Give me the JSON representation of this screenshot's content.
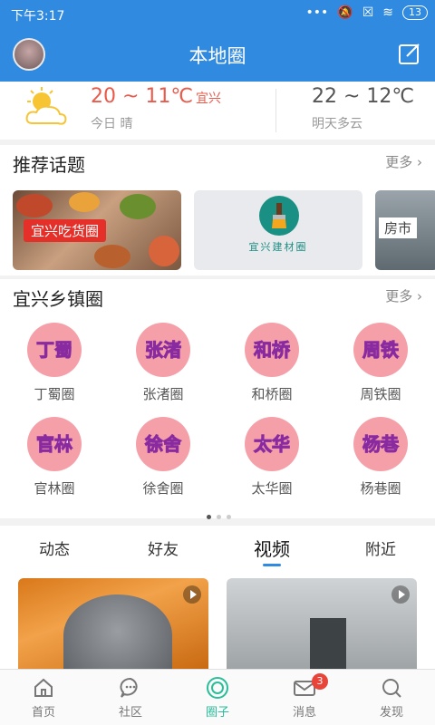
{
  "status_bar": {
    "time": "下午3:17",
    "battery": "13"
  },
  "header": {
    "title": "本地圈"
  },
  "weather": {
    "today_temp": "20 ~ 11℃",
    "city": "宜兴",
    "today_label": "今日 晴",
    "tomorrow_temp": "22 ~ 12℃",
    "tomorrow_label": "明天多云"
  },
  "topics": {
    "title": "推荐话题",
    "more": "更多",
    "cards": [
      {
        "label": "宜兴吃货圈"
      },
      {
        "label": "宜兴建材圈"
      },
      {
        "label": "房市"
      }
    ]
  },
  "towns": {
    "title": "宜兴乡镇圈",
    "more": "更多",
    "items": [
      {
        "badge": "丁蜀",
        "label": "丁蜀圈"
      },
      {
        "badge": "张渚",
        "label": "张渚圈"
      },
      {
        "badge": "和桥",
        "label": "和桥圈"
      },
      {
        "badge": "周铁",
        "label": "周铁圈"
      },
      {
        "badge": "官林",
        "label": "官林圈"
      },
      {
        "badge": "徐舍",
        "label": "徐舍圈"
      },
      {
        "badge": "太华",
        "label": "太华圈"
      },
      {
        "badge": "杨巷",
        "label": "杨巷圈"
      }
    ]
  },
  "tabs": [
    {
      "label": "动态"
    },
    {
      "label": "好友"
    },
    {
      "label": "视频"
    },
    {
      "label": "附近"
    }
  ],
  "bottom_nav": [
    {
      "label": "首页",
      "icon": "home-icon"
    },
    {
      "label": "社区",
      "icon": "chat-icon"
    },
    {
      "label": "圈子",
      "icon": "circle-icon"
    },
    {
      "label": "消息",
      "icon": "mail-icon",
      "badge": "3"
    },
    {
      "label": "发现",
      "icon": "search-icon"
    }
  ],
  "colors": {
    "primary": "#2f8ae0",
    "accent": "#2bbd9a",
    "temp": "#e85b4b"
  }
}
